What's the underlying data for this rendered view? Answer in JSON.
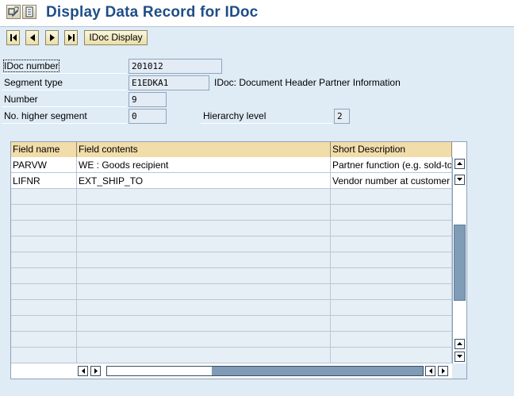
{
  "window": {
    "title": "Display Data Record for IDoc"
  },
  "toolbar": {
    "nav": [
      "first",
      "previous",
      "next",
      "last"
    ],
    "idoc_display_label": "IDoc Display"
  },
  "header_fields": {
    "idoc_number_label": "IDoc number",
    "idoc_number_value": "201012",
    "segment_type_label": "Segment type",
    "segment_type_value": "E1EDKA1",
    "segment_description": "IDoc: Document Header Partner Information",
    "number_label": "Number",
    "number_value": "9",
    "higher_segment_label": "No. higher segment",
    "higher_segment_value": "0",
    "hierarchy_label": "Hierarchy level",
    "hierarchy_value": "2"
  },
  "table": {
    "columns": [
      "Field name",
      "Field contents",
      "Short Description"
    ],
    "rows": [
      [
        "PARVW",
        "WE  : Goods recipient",
        "Partner function (e.g. sold-to"
      ],
      [
        "LIFNR",
        "EXT_SHIP_TO",
        "Vendor number at customer"
      ]
    ],
    "empty_rows": 11
  },
  "icons": {
    "title_icons": [
      "display-change-icon",
      "document-icon"
    ],
    "scroll": [
      "scroll-up-icon",
      "scroll-down-icon",
      "scroll-left-icon",
      "scroll-right-icon"
    ]
  },
  "colors": {
    "title": "#1f4e86",
    "background": "#dfebf5",
    "table_header": "#f1ddaa",
    "field_bg": "#e3ecf5",
    "scroll_thumb": "#7f9bb6"
  }
}
